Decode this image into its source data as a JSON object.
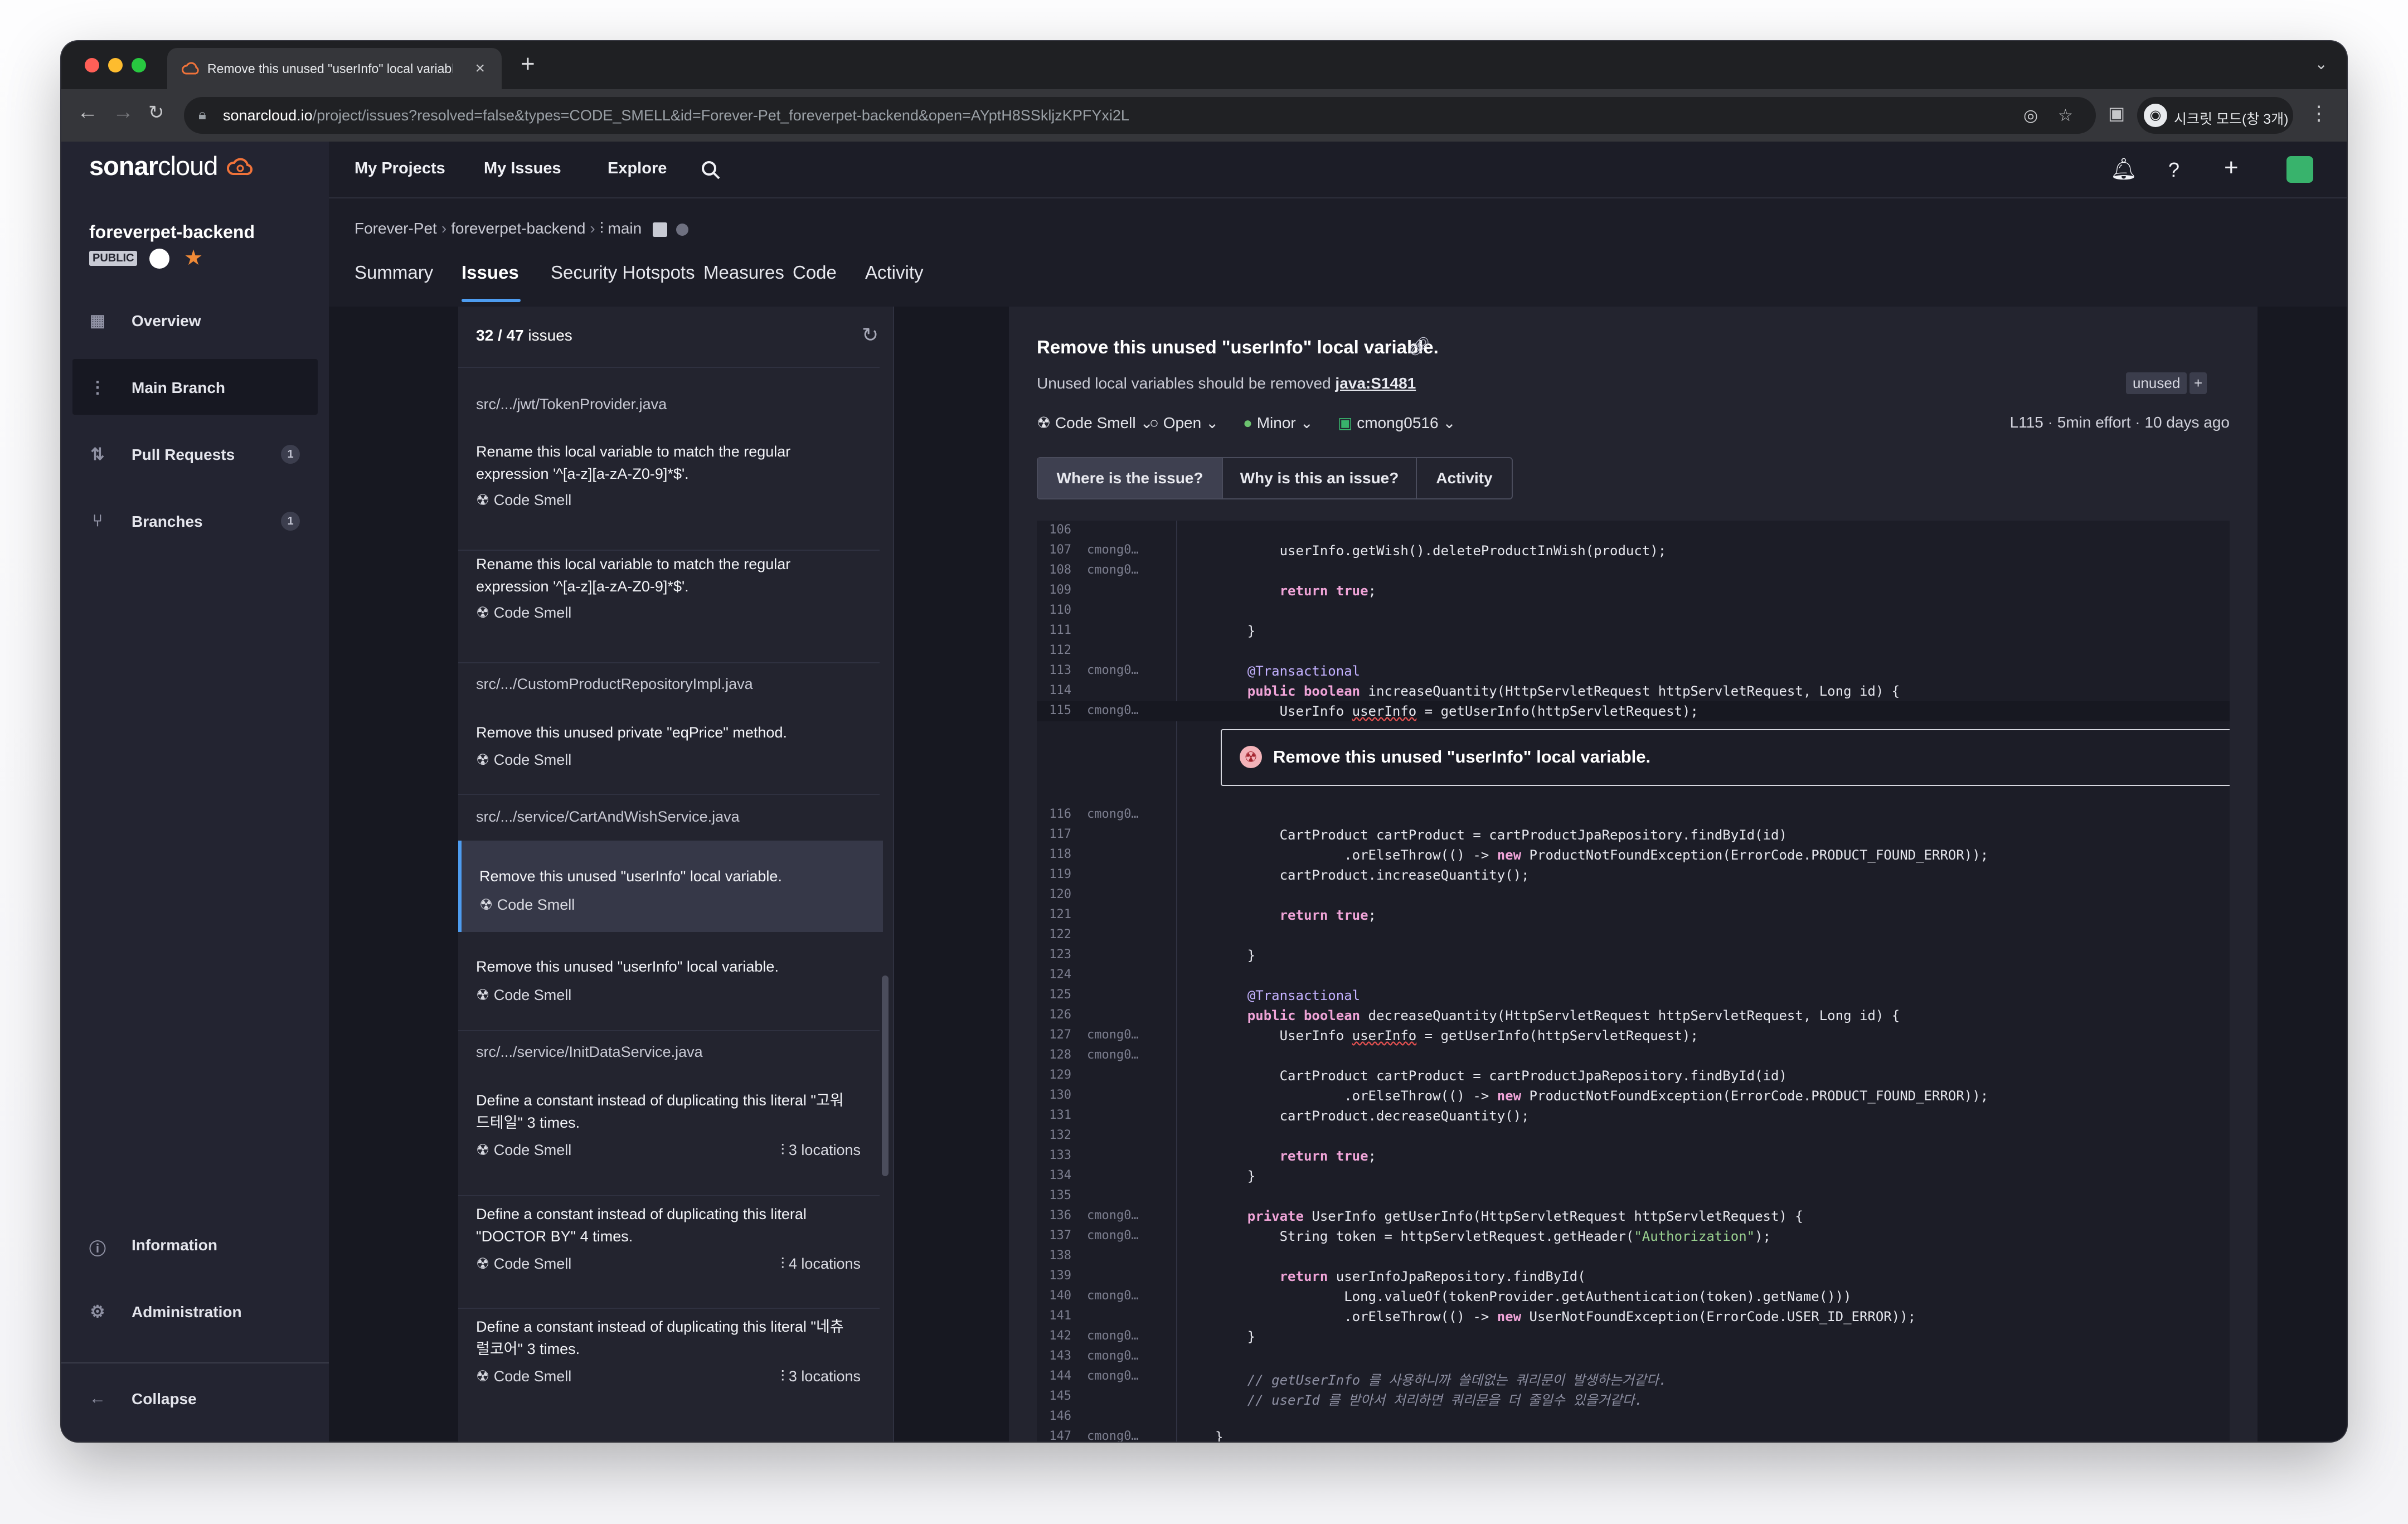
{
  "browser": {
    "tab_title": "Remove this unused \"userInfo\" local variable.",
    "url_host": "sonarcloud.io",
    "url_path": "/project/issues?resolved=false&types=CODE_SMELL&id=Forever-Pet_foreverpet-backend&open=AYptH8SSkljzKPFYxi2L",
    "profile_label": "시크릿 모드(창 3개)",
    "new_tab": "+",
    "tab_close": "×"
  },
  "brand": {
    "name_bold": "sonar",
    "name_light": "cloud"
  },
  "project": {
    "name": "foreverpet-backend",
    "visibility": "PUBLIC"
  },
  "sidebar": {
    "items": [
      {
        "label": "Overview",
        "icon": "overview-icon"
      },
      {
        "label": "Main Branch",
        "icon": "branch-icon"
      },
      {
        "label": "Pull Requests",
        "icon": "pull-request-icon",
        "count": "1"
      },
      {
        "label": "Branches",
        "icon": "branches-icon",
        "count": "1"
      }
    ],
    "bottom": [
      {
        "label": "Information",
        "icon": "info-icon"
      },
      {
        "label": "Administration",
        "icon": "gear-icon"
      }
    ],
    "collapse": "Collapse"
  },
  "topnav": {
    "links": [
      "My Projects",
      "My Issues",
      "Explore"
    ]
  },
  "breadcrumb": {
    "org": "Forever-Pet",
    "project": "foreverpet-backend",
    "branch": "main"
  },
  "project_tabs": [
    "Summary",
    "Issues",
    "Security Hotspots",
    "Measures",
    "Code",
    "Activity"
  ],
  "issues_list": {
    "count_current": "32",
    "count_total": "/ 47",
    "count_suffix": "issues",
    "groups": [
      {
        "file": "src/.../jwt/TokenProvider.java"
      },
      {
        "file": "src/.../CustomProductRepositoryImpl.java"
      },
      {
        "file": "src/.../service/CartAndWishService.java"
      },
      {
        "file": "src/.../service/InitDataService.java"
      }
    ],
    "issues": [
      {
        "message": "Rename this local variable to match the regular expression '^[a-z][a-zA-Z0-9]*$'.",
        "type": "Code Smell"
      },
      {
        "message": "Rename this local variable to match the regular expression '^[a-z][a-zA-Z0-9]*$'.",
        "type": "Code Smell"
      },
      {
        "message": "Remove this unused private \"eqPrice\" method.",
        "type": "Code Smell"
      },
      {
        "message": "Remove this unused \"userInfo\" local variable.",
        "type": "Code Smell",
        "selected": true
      },
      {
        "message": "Remove this unused \"userInfo\" local variable.",
        "type": "Code Smell"
      },
      {
        "message": "Define a constant instead of duplicating this literal \"고워드테일\" 3 times.",
        "type": "Code Smell",
        "locations": "3 locations"
      },
      {
        "message": "Define a constant instead of duplicating this literal \"DOCTOR BY\" 4 times.",
        "type": "Code Smell",
        "locations": "4 locations"
      },
      {
        "message": "Define a constant instead of duplicating this literal \"네츄럴코어\" 3 times.",
        "type": "Code Smell",
        "locations": "3 locations"
      }
    ]
  },
  "issue_detail": {
    "title": "Remove this unused \"userInfo\" local variable.",
    "rule_text": "Unused local variables should be removed",
    "rule_key": "java:S1481",
    "tag": "unused",
    "tag_add": "+",
    "type": "Code Smell",
    "status": "Open",
    "severity": "Minor",
    "assignee": "cmong0516",
    "line": "L115",
    "effort": "5min effort",
    "age": "10 days ago",
    "tabs": [
      "Where is the issue?",
      "Why is this an issue?",
      "Activity"
    ],
    "inline_message": "Remove this unused \"userInfo\" local variable."
  },
  "code_lines": [
    {
      "n": "106",
      "a": "",
      "c": ""
    },
    {
      "n": "107",
      "a": "cmong0…",
      "c": "        userInfo.getWish().deleteProductInWish(product);"
    },
    {
      "n": "108",
      "a": "cmong0…",
      "c": ""
    },
    {
      "n": "109",
      "a": "",
      "c": "        return true;"
    },
    {
      "n": "110",
      "a": "",
      "c": ""
    },
    {
      "n": "111",
      "a": "",
      "c": "    }"
    },
    {
      "n": "112",
      "a": "",
      "c": ""
    },
    {
      "n": "113",
      "a": "cmong0…",
      "c": "    @Transactional"
    },
    {
      "n": "114",
      "a": "",
      "c": "    public boolean increaseQuantity(HttpServletRequest httpServletRequest, Long id) {"
    },
    {
      "n": "115",
      "a": "cmong0…",
      "c": "        UserInfo userInfo = getUserInfo(httpServletRequest);"
    },
    {
      "n": "116",
      "a": "cmong0…",
      "c": ""
    },
    {
      "n": "117",
      "a": "",
      "c": "        CartProduct cartProduct = cartProductJpaRepository.findById(id)"
    },
    {
      "n": "118",
      "a": "",
      "c": "                .orElseThrow(() -> new ProductNotFoundException(ErrorCode.PRODUCT_FOUND_ERROR));"
    },
    {
      "n": "119",
      "a": "",
      "c": "        cartProduct.increaseQuantity();"
    },
    {
      "n": "120",
      "a": "",
      "c": ""
    },
    {
      "n": "121",
      "a": "",
      "c": "        return true;"
    },
    {
      "n": "122",
      "a": "",
      "c": ""
    },
    {
      "n": "123",
      "a": "",
      "c": "    }"
    },
    {
      "n": "124",
      "a": "",
      "c": ""
    },
    {
      "n": "125",
      "a": "",
      "c": "    @Transactional"
    },
    {
      "n": "126",
      "a": "",
      "c": "    public boolean decreaseQuantity(HttpServletRequest httpServletRequest, Long id) {"
    },
    {
      "n": "127",
      "a": "cmong0…",
      "c": "        UserInfo userInfo = getUserInfo(httpServletRequest);"
    },
    {
      "n": "128",
      "a": "cmong0…",
      "c": ""
    },
    {
      "n": "129",
      "a": "",
      "c": "        CartProduct cartProduct = cartProductJpaRepository.findById(id)"
    },
    {
      "n": "130",
      "a": "",
      "c": "                .orElseThrow(() -> new ProductNotFoundException(ErrorCode.PRODUCT_FOUND_ERROR));"
    },
    {
      "n": "131",
      "a": "",
      "c": "        cartProduct.decreaseQuantity();"
    },
    {
      "n": "132",
      "a": "",
      "c": ""
    },
    {
      "n": "133",
      "a": "",
      "c": "        return true;"
    },
    {
      "n": "134",
      "a": "",
      "c": "    }"
    },
    {
      "n": "135",
      "a": "",
      "c": ""
    },
    {
      "n": "136",
      "a": "cmong0…",
      "c": "    private UserInfo getUserInfo(HttpServletRequest httpServletRequest) {"
    },
    {
      "n": "137",
      "a": "cmong0…",
      "c": "        String token = httpServletRequest.getHeader(\"Authorization\");"
    },
    {
      "n": "138",
      "a": "",
      "c": ""
    },
    {
      "n": "139",
      "a": "",
      "c": "        return userInfoJpaRepository.findById("
    },
    {
      "n": "140",
      "a": "cmong0…",
      "c": "                Long.valueOf(tokenProvider.getAuthentication(token).getName()))"
    },
    {
      "n": "141",
      "a": "",
      "c": "                .orElseThrow(() -> new UserNotFoundException(ErrorCode.USER_ID_ERROR));"
    },
    {
      "n": "142",
      "a": "cmong0…",
      "c": "    }"
    },
    {
      "n": "143",
      "a": "cmong0…",
      "c": ""
    },
    {
      "n": "144",
      "a": "cmong0…",
      "c": "    // getUserInfo 를 사용하니까 쓸데없는 쿼리문이 발생하는거같다."
    },
    {
      "n": "145",
      "a": "",
      "c": "    // userId 를 받아서 처리하면 쿼리문을 더 줄일수 있을거같다."
    },
    {
      "n": "146",
      "a": "",
      "c": ""
    },
    {
      "n": "147",
      "a": "cmong0…",
      "c": "}"
    }
  ]
}
